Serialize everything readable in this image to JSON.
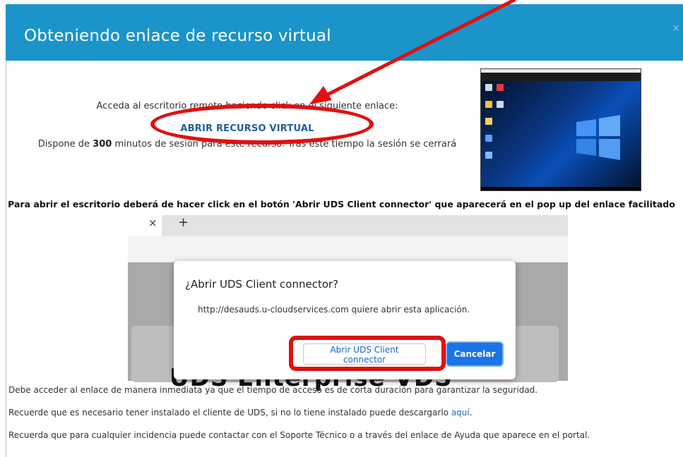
{
  "modal": {
    "title": "Obteniendo enlace de recurso virtual",
    "close_glyph": "×"
  },
  "intro": {
    "line1": "Acceda al escritorio remoto haciendo click en el siguiente enlace:",
    "link_label": "ABRIR RECURSO VIRTUAL",
    "session_prefix": "Dispone de ",
    "session_minutes": "300",
    "session_suffix": " minutos de sesión para este recurso. Tras este tiempo la sesión se cerrará"
  },
  "instruction": "Para abrir el escritorio deberá de hacer click en el botón 'Abrir UDS Client connector' que aparecerá en el pop up del enlace facilitado",
  "browser": {
    "tab_close_glyph": "×",
    "new_tab_glyph": "+",
    "page_text": "UDS Enterprise VDS"
  },
  "dialog": {
    "title": "¿Abrir UDS Client connector?",
    "message": "http://desauds.u-cloudservices.com quiere abrir esta aplicación.",
    "open_label": "Abrir UDS Client connector",
    "cancel_label": "Cancelar"
  },
  "footer": {
    "line1": "Debe acceder al enlace de manera inmediata ya que el tiempo de acceso es de corta duración para garantizar la seguridad.",
    "line2_prefix": "Recuerde que es necesario tener instalado el cliente de UDS, si no lo tiene instalado puede descargarlo ",
    "line2_link": "aquí",
    "line2_suffix": ".",
    "line3": "Recuerda que para cualquier incidencia puede contactar con el Soporte Técnico o a través del enlace de Ayuda que aparece en el portal."
  },
  "colors": {
    "header": "#1a94c9",
    "link": "#1f5f99",
    "annotation": "#e01010",
    "primary_button": "#1a73e8"
  }
}
